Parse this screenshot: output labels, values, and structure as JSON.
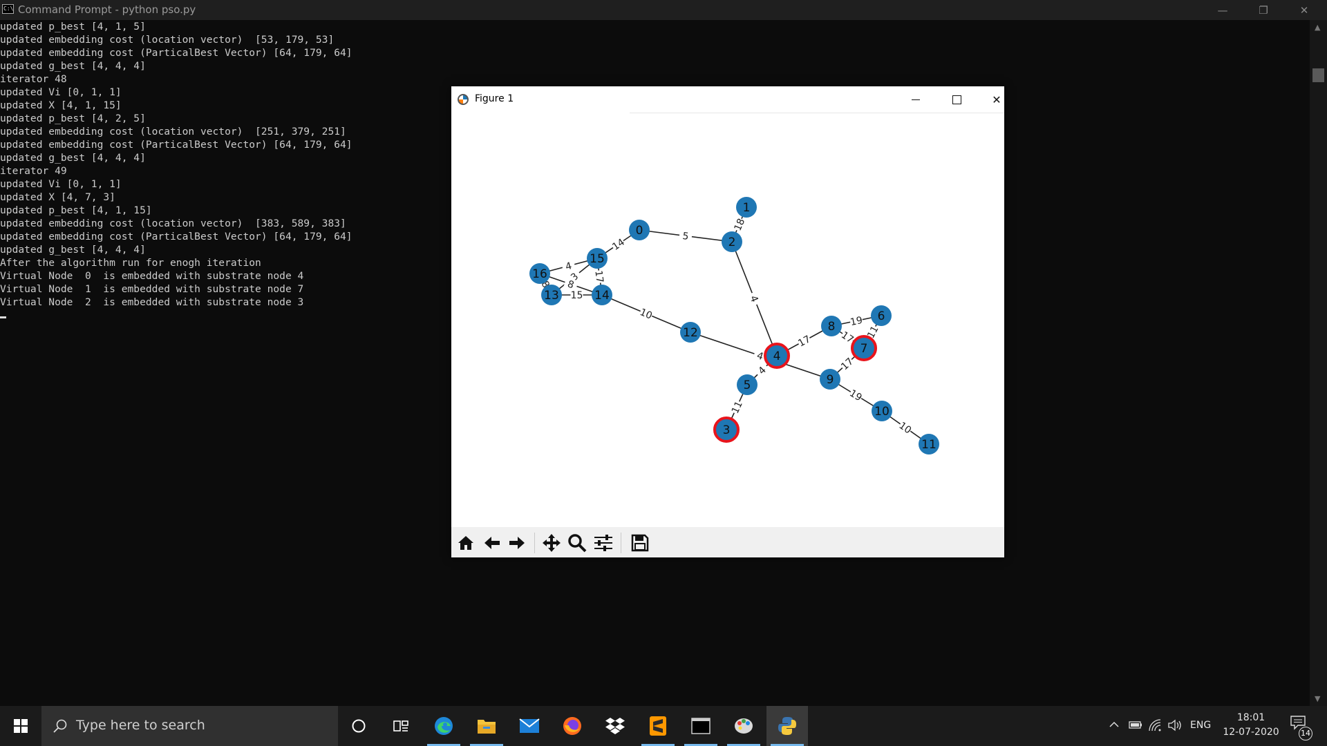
{
  "console_window": {
    "title": "Command Prompt - python  pso.py",
    "icon": "console-icon",
    "lines": [
      "updated p_best [4, 1, 5]",
      "updated embedding cost (location vector)  [53, 179, 53]",
      "updated embedding cost (ParticalBest Vector) [64, 179, 64]",
      "updated g_best [4, 4, 4]",
      "iterator 48",
      "updated Vi [0, 1, 1]",
      "updated X [4, 1, 15]",
      "updated p_best [4, 2, 5]",
      "updated embedding cost (location vector)  [251, 379, 251]",
      "updated embedding cost (ParticalBest Vector) [64, 179, 64]",
      "updated g_best [4, 4, 4]",
      "iterator 49",
      "updated Vi [0, 1, 1]",
      "updated X [4, 7, 3]",
      "updated p_best [4, 1, 15]",
      "updated embedding cost (location vector)  [383, 589, 383]",
      "updated embedding cost (ParticalBest Vector) [64, 179, 64]",
      "updated g_best [4, 4, 4]",
      "After the algorithm run for enogh iteration",
      "Virtual Node  0  is embedded with substrate node 4",
      "Virtual Node  1  is embedded with substrate node 7",
      "Virtual Node  2  is embedded with substrate node 3"
    ]
  },
  "figure_window": {
    "title": "Figure 1",
    "icon": "matplotlib-logo-icon",
    "toolbar": [
      "home-icon",
      "back-arrow-icon",
      "forward-arrow-icon",
      "pan-icon",
      "zoom-icon",
      "configure-subplots-icon",
      "save-icon"
    ]
  },
  "colors": {
    "node_fill": "#1f77b4",
    "highlight_border": "#e8141c",
    "edge": "#222222",
    "console_text": "#cccccc",
    "taskbar": "#1b1b1b"
  },
  "graph": {
    "nodes": [
      {
        "id": "0",
        "highlighted": false
      },
      {
        "id": "1",
        "highlighted": false
      },
      {
        "id": "2",
        "highlighted": false
      },
      {
        "id": "3",
        "highlighted": true
      },
      {
        "id": "4",
        "highlighted": true
      },
      {
        "id": "5",
        "highlighted": false
      },
      {
        "id": "6",
        "highlighted": false
      },
      {
        "id": "7",
        "highlighted": true
      },
      {
        "id": "8",
        "highlighted": false
      },
      {
        "id": "9",
        "highlighted": false
      },
      {
        "id": "10",
        "highlighted": false
      },
      {
        "id": "11",
        "highlighted": false
      },
      {
        "id": "12",
        "highlighted": false
      },
      {
        "id": "13",
        "highlighted": false
      },
      {
        "id": "14",
        "highlighted": false
      },
      {
        "id": "15",
        "highlighted": false
      },
      {
        "id": "16",
        "highlighted": false
      }
    ],
    "edges": [
      {
        "source": "0",
        "target": "2",
        "weight": "5"
      },
      {
        "source": "0",
        "target": "15",
        "weight": "14"
      },
      {
        "source": "1",
        "target": "2",
        "weight": "18"
      },
      {
        "source": "2",
        "target": "4",
        "weight": "4"
      },
      {
        "source": "15",
        "target": "16",
        "weight": "4"
      },
      {
        "source": "15",
        "target": "14",
        "weight": "17"
      },
      {
        "source": "15",
        "target": "13",
        "weight": "3"
      },
      {
        "source": "16",
        "target": "14",
        "weight": "8"
      },
      {
        "source": "16",
        "target": "13",
        "weight": "8"
      },
      {
        "source": "13",
        "target": "14",
        "weight": "15"
      },
      {
        "source": "14",
        "target": "12",
        "weight": "10"
      },
      {
        "source": "12",
        "target": "9",
        "weight": "4"
      },
      {
        "source": "4",
        "target": "5",
        "weight": "4"
      },
      {
        "source": "4",
        "target": "8",
        "weight": "17"
      },
      {
        "source": "8",
        "target": "6",
        "weight": "19"
      },
      {
        "source": "8",
        "target": "7",
        "weight": "17"
      },
      {
        "source": "6",
        "target": "7",
        "weight": "11"
      },
      {
        "source": "7",
        "target": "9",
        "weight": "17"
      },
      {
        "source": "9",
        "target": "10",
        "weight": "19"
      },
      {
        "source": "10",
        "target": "11",
        "weight": "10"
      },
      {
        "source": "5",
        "target": "3",
        "weight": "11"
      }
    ]
  },
  "taskbar": {
    "start": "windows-start-icon",
    "search_placeholder": "Type here to search",
    "apps": [
      "cortana-icon",
      "task-view-icon",
      "edge-icon",
      "file-explorer-icon",
      "mail-icon",
      "firefox-icon",
      "dropbox-icon",
      "sublime-text-icon",
      "terminal-icon",
      "paint-icon",
      "python-icon"
    ],
    "language": "ENG",
    "time": "18:01",
    "date": "12-07-2020",
    "notification_count": "14"
  }
}
